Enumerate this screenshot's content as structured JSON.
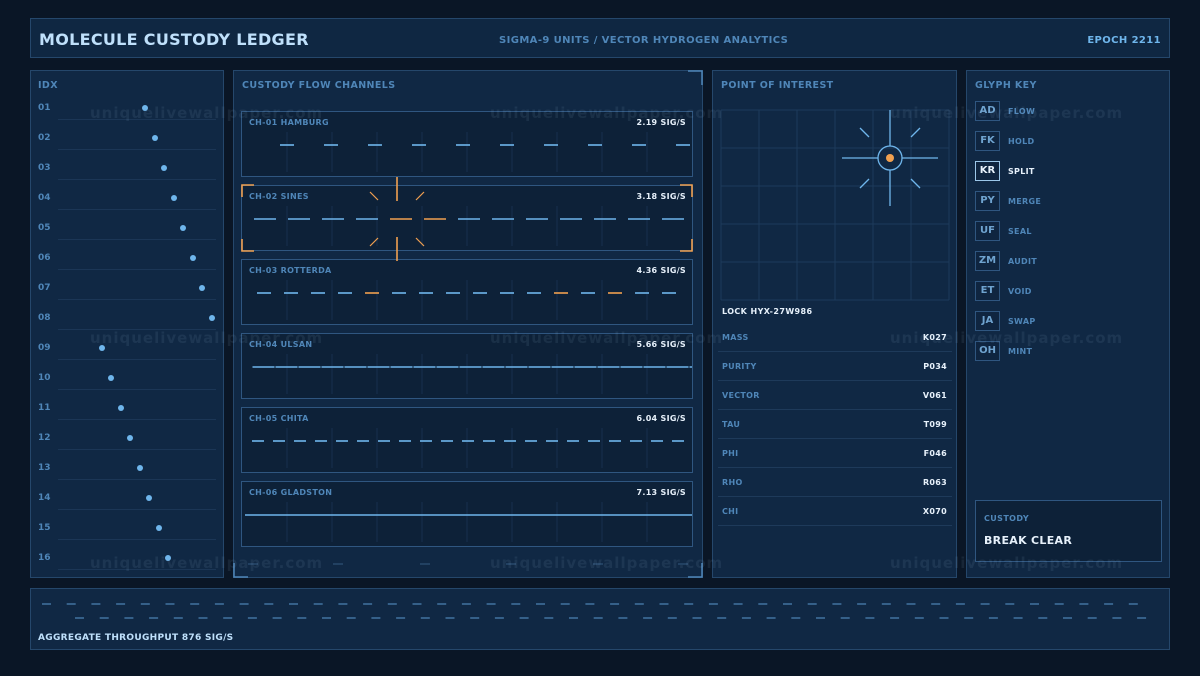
{
  "header": {
    "title": "MOLECULE CUSTODY LEDGER",
    "subtitle": "SIGMA-9 UNITS / VECTOR HYDROGEN ANALYTICS",
    "epoch": "EPOCH 2211"
  },
  "watermark": "uniquelivewallpaper.com",
  "idx_panel": {
    "title": "IDX",
    "rows": [
      {
        "label": "01",
        "level": 0.46
      },
      {
        "label": "02",
        "level": 0.51
      },
      {
        "label": "03",
        "level": 0.56
      },
      {
        "label": "04",
        "level": 0.61
      },
      {
        "label": "05",
        "level": 0.66
      },
      {
        "label": "06",
        "level": 0.71
      },
      {
        "label": "07",
        "level": 0.76
      },
      {
        "label": "08",
        "level": 0.81
      },
      {
        "label": "09",
        "level": 0.23
      },
      {
        "label": "10",
        "level": 0.28
      },
      {
        "label": "11",
        "level": 0.33
      },
      {
        "label": "12",
        "level": 0.38
      },
      {
        "label": "13",
        "level": 0.43
      },
      {
        "label": "14",
        "level": 0.48
      },
      {
        "label": "15",
        "level": 0.53
      },
      {
        "label": "16",
        "level": 0.58
      }
    ]
  },
  "flow_panel": {
    "title": "CUSTODY FLOW CHANNELS",
    "channels": [
      {
        "name": "CH-01 HAMBURG",
        "rate": "2.19 SIG/S",
        "selected": false
      },
      {
        "name": "CH-02 SINES",
        "rate": "3.18 SIG/S",
        "selected": true
      },
      {
        "name": "CH-03 ROTTERDA",
        "rate": "4.36 SIG/S",
        "selected": false
      },
      {
        "name": "CH-04 ULSAN",
        "rate": "5.66 SIG/S",
        "selected": false
      },
      {
        "name": "CH-05 CHITA",
        "rate": "6.04 SIG/S",
        "selected": false
      },
      {
        "name": "CH-06 GLADSTON",
        "rate": "7.13 SIG/S",
        "selected": false
      }
    ]
  },
  "poi_panel": {
    "title": "POINT OF INTEREST",
    "lock": "LOCK HYX-27W986",
    "metrics": [
      {
        "label": "MASS",
        "value": "K027"
      },
      {
        "label": "PURITY",
        "value": "P034"
      },
      {
        "label": "VECTOR",
        "value": "V061"
      },
      {
        "label": "TAU",
        "value": "T099"
      },
      {
        "label": "PHI",
        "value": "F046"
      },
      {
        "label": "RHO",
        "value": "R063"
      },
      {
        "label": "CHI",
        "value": "X070"
      }
    ]
  },
  "glyph_panel": {
    "title": "GLYPH KEY",
    "glyphs": [
      {
        "code": "AD",
        "name": "FLOW",
        "selected": false
      },
      {
        "code": "FK",
        "name": "HOLD",
        "selected": false
      },
      {
        "code": "KR",
        "name": "SPLIT",
        "selected": true
      },
      {
        "code": "PY",
        "name": "MERGE",
        "selected": false
      },
      {
        "code": "UF",
        "name": "SEAL",
        "selected": false
      },
      {
        "code": "ZM",
        "name": "AUDIT",
        "selected": false
      },
      {
        "code": "ET",
        "name": "VOID",
        "selected": false
      },
      {
        "code": "JA",
        "name": "SWAP",
        "selected": false
      },
      {
        "code": "OH",
        "name": "MINT",
        "selected": false
      }
    ],
    "custody_label": "CUSTODY",
    "custody_value": "BREAK CLEAR"
  },
  "footer": {
    "throughput": "AGGREGATE THROUGHPUT 876 SIG/S"
  },
  "colors": {
    "accent": "#6fb6ec",
    "highlight": "#f0a050",
    "text_bright": "#e7f1fb",
    "text_dim": "#4f86b8"
  }
}
